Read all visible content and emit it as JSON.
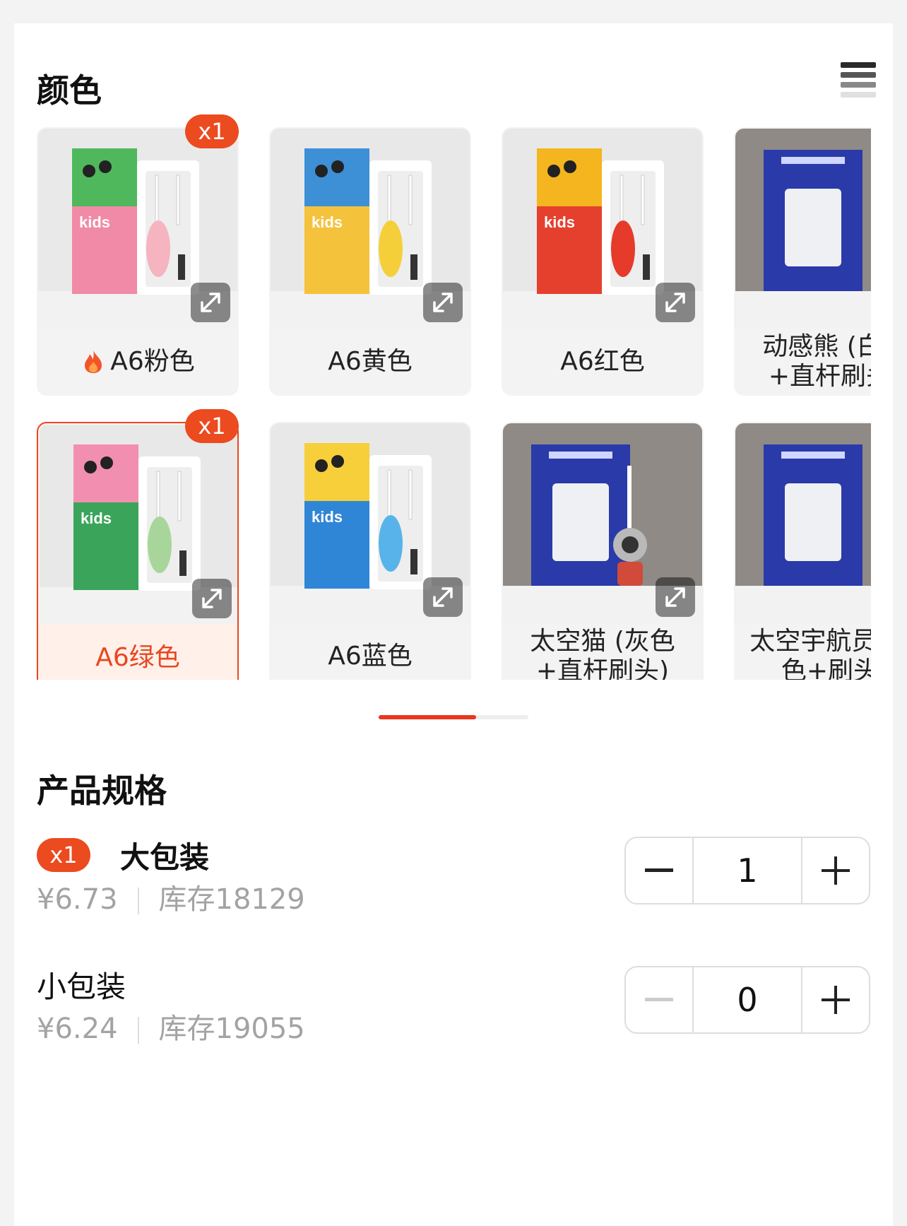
{
  "color_section": {
    "title": "颜色",
    "items": [
      {
        "label": "A6粉色",
        "hot": true,
        "badge": "x1",
        "selected": false,
        "box_color": "#4fb85c",
        "box_accent": "#f08aa6",
        "brush_color": "#f5b4c0",
        "bg": "#e9e9ea",
        "expand": true
      },
      {
        "label": "A6黄色",
        "hot": false,
        "badge": "",
        "selected": false,
        "box_color": "#3d8fd6",
        "box_accent": "#f5c23c",
        "brush_color": "#f4cf3a",
        "bg": "#e8e8e8",
        "expand": true
      },
      {
        "label": "A6红色",
        "hot": false,
        "badge": "",
        "selected": false,
        "box_color": "#f4b51e",
        "box_accent": "#e5402e",
        "brush_color": "#e63a2a",
        "bg": "#e8e8e8",
        "expand": true
      },
      {
        "label": "动感熊 (白色+直杆刷头)",
        "hot": false,
        "badge": "",
        "selected": false,
        "box_color": "#2a3aa8",
        "box_accent": "#2a3aa8",
        "brush_color": "#ffffff",
        "bg": "#8f8a86",
        "expand": false
      },
      {
        "label": "A6绿色",
        "hot": false,
        "badge": "x1",
        "selected": true,
        "box_color": "#f28fb0",
        "box_accent": "#3aa55a",
        "brush_color": "#a8d69a",
        "bg": "#e8e8e8",
        "expand": true
      },
      {
        "label": "A6蓝色",
        "hot": false,
        "badge": "",
        "selected": false,
        "box_color": "#f7cf3a",
        "box_accent": "#2f86d6",
        "brush_color": "#58b3ea",
        "bg": "#e8e8e8",
        "expand": true
      },
      {
        "label": "太空猫 (灰色+直杆刷头)",
        "hot": false,
        "badge": "",
        "selected": false,
        "box_color": "#2a3aa8",
        "box_accent": "#2a3aa8",
        "brush_color": "#9a9a9a",
        "bg": "#8f8a86",
        "expand": true
      },
      {
        "label": "太空宇航员 (白色+刷头)",
        "hot": false,
        "badge": "",
        "selected": false,
        "box_color": "#2a3aa8",
        "box_accent": "#2a3aa8",
        "brush_color": "#ffffff",
        "bg": "#8f8a86",
        "expand": false
      }
    ],
    "scroll_progress": 0.65
  },
  "spec_section": {
    "title": "产品规格",
    "items": [
      {
        "badge": "x1",
        "name": "大包装",
        "price": "¥6.73",
        "stock": "库存18129",
        "quantity": "1",
        "minus_enabled": true
      },
      {
        "badge": "",
        "name": "小包装",
        "price": "¥6.24",
        "stock": "库存19055",
        "quantity": "0",
        "minus_enabled": false
      }
    ]
  },
  "colors": {
    "accent": "#e9471f",
    "badge": "#ec4a1f",
    "progress": "#e9371f"
  }
}
